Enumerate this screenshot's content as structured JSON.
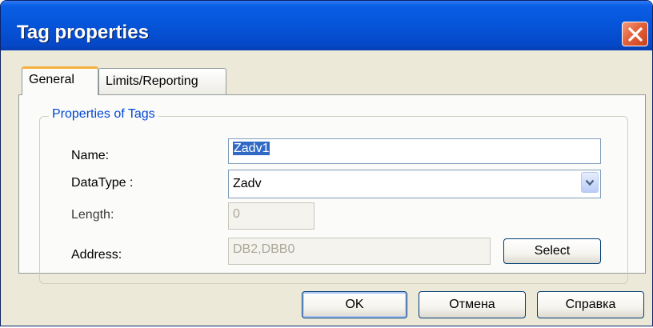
{
  "window": {
    "title": "Tag properties"
  },
  "tabs": [
    {
      "label": "General",
      "selected": true
    },
    {
      "label": "Limits/Reporting",
      "selected": false
    }
  ],
  "group": {
    "title": "Properties of Tags"
  },
  "fields": {
    "name": {
      "label": "Name:",
      "value": "Zadv1"
    },
    "datatype": {
      "label": "DataType :",
      "value": "Zadv"
    },
    "length": {
      "label": "Length:",
      "value": "0"
    },
    "address": {
      "label": "Address:",
      "value": "DB2,DBB0"
    }
  },
  "buttons": {
    "select": "Select",
    "ok": "OK",
    "cancel": "Отмена",
    "help": "Справка"
  },
  "colors": {
    "titlebar": "#0654d8",
    "close_button": "#e3623c",
    "group_title": "#0046d5",
    "selection": "#316ac5",
    "dialog_face": "#ece9d8"
  },
  "icons": {
    "close": "close-icon",
    "dropdown": "chevron-down-icon"
  }
}
